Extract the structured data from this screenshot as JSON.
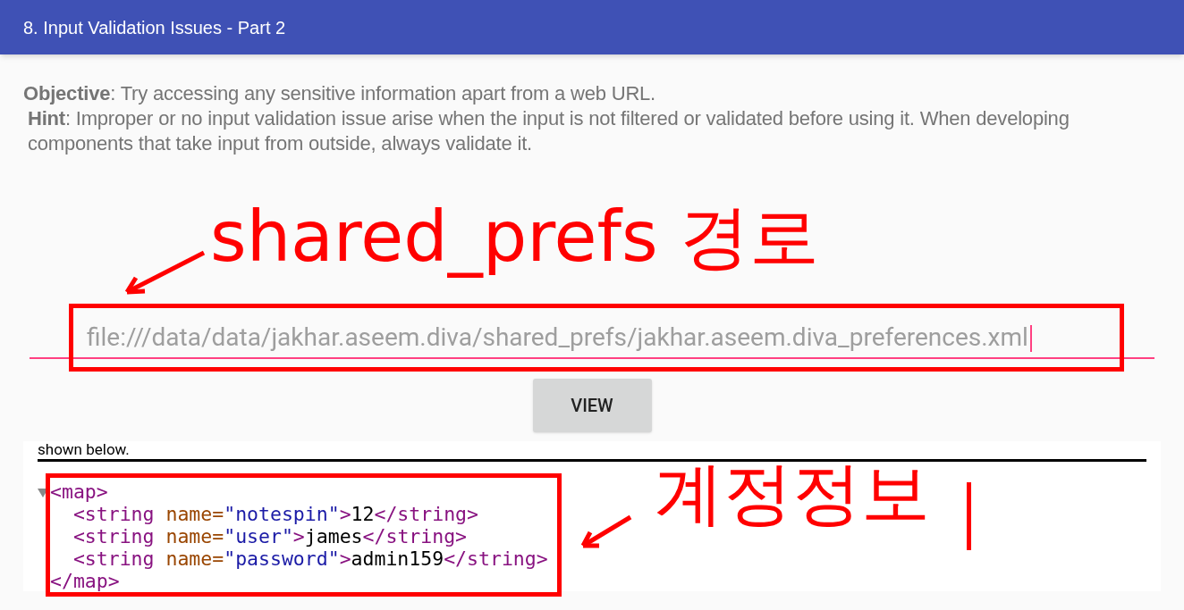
{
  "app_bar": {
    "title": "8. Input Validation Issues - Part 2"
  },
  "description": {
    "objective": "**Objective**: Try accessing any sensitive information apart from a web URL.",
    "hint": "**Hint**: Improper or no input validation issue arise when the input is not filtered or validated before using it. When developing components that take input from outside, always validate it."
  },
  "url_field": {
    "value": "file:///data/data/jakhar.aseem.diva/shared_prefs/jakhar.aseem.diva_preferences.xml",
    "focused": true
  },
  "view_button": {
    "label": "VIEW"
  },
  "web_view": {
    "partial_text": "shown below.",
    "xml_lines": [
      [
        {
          "kind": "tag",
          "text": "<map>"
        }
      ],
      [
        {
          "kind": "tag",
          "text": "  <string "
        },
        {
          "kind": "attr",
          "text": "name="
        },
        {
          "kind": "value",
          "text": "\"notespin\""
        },
        {
          "kind": "tag",
          "text": ">"
        },
        {
          "kind": "text",
          "text": "12"
        },
        {
          "kind": "tag",
          "text": "</string>"
        }
      ],
      [
        {
          "kind": "tag",
          "text": "  <string "
        },
        {
          "kind": "attr",
          "text": "name="
        },
        {
          "kind": "value",
          "text": "\"user\""
        },
        {
          "kind": "tag",
          "text": ">"
        },
        {
          "kind": "text",
          "text": "james"
        },
        {
          "kind": "tag",
          "text": "</string>"
        }
      ],
      [
        {
          "kind": "tag",
          "text": "  <string "
        },
        {
          "kind": "attr",
          "text": "name="
        },
        {
          "kind": "value",
          "text": "\"password\""
        },
        {
          "kind": "tag",
          "text": ">"
        },
        {
          "kind": "text",
          "text": "admin159"
        },
        {
          "kind": "tag",
          "text": "</string>"
        }
      ],
      [
        {
          "kind": "tag",
          "text": "</map>"
        }
      ]
    ]
  },
  "annotations": [
    {
      "text": "shared_prefs 경로"
    },
    {
      "text": "계정정보"
    }
  ]
}
